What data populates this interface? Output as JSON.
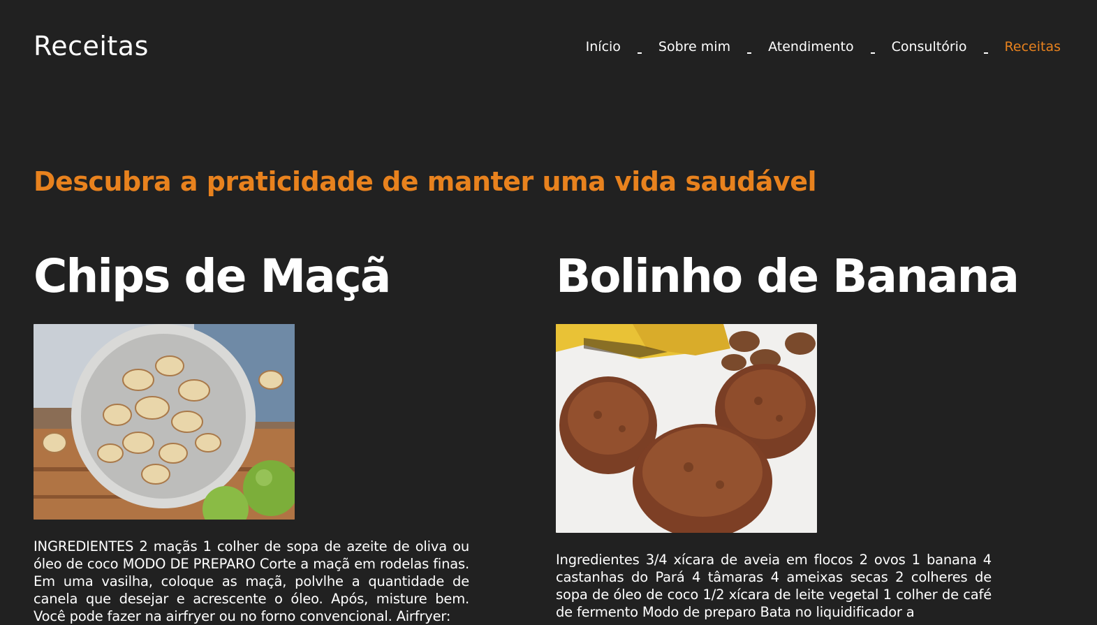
{
  "header": {
    "logo": "Receitas",
    "nav": [
      {
        "label": "Início",
        "active": false
      },
      {
        "label": "Sobre mim",
        "active": false
      },
      {
        "label": "Atendimento",
        "active": false
      },
      {
        "label": "Consultório",
        "active": false
      },
      {
        "label": "Receitas",
        "active": true
      }
    ]
  },
  "tagline": "Descubra a praticidade de manter uma vida saudável",
  "recipes": [
    {
      "title": "Chips de Maçã",
      "description": "INGREDIENTES 2 maçãs 1 colher de sopa de azeite de oliva ou óleo de coco MODO DE PREPARO Corte a maçã em rodelas finas. Em uma vasilha, coloque as maçã, polvlhe a quantidade de canela que desejar e acrescente o óleo. Após, misture bem. Você pode fazer na airfryer ou no forno convencional. Airfryer:"
    },
    {
      "title": "Bolinho de Banana",
      "description": "Ingredientes 3/4 xícara de aveia em flocos 2 ovos 1 banana 4 castanhas do Pará 4 tâmaras 4 ameixas secas 2 colheres de sopa de óleo de coco 1/2 xícara de leite vegetal 1 colher de café de fermento Modo de preparo Bata no liquidificador a"
    }
  ],
  "colors": {
    "background": "#212121",
    "accent": "#e8821e",
    "text": "#ffffff"
  }
}
